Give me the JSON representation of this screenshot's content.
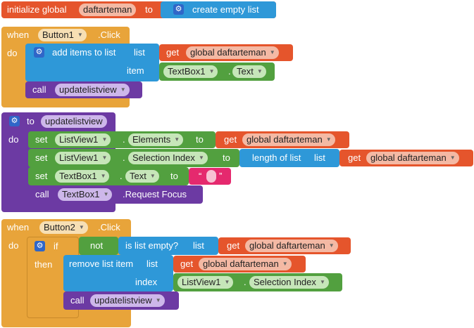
{
  "global_block": {
    "initialize_label": "initialize global",
    "var_name": "daftarteman",
    "to_label": "to",
    "create_label": "create empty list"
  },
  "button1_block": {
    "when_label": "when",
    "component": "Button1",
    "event": ".Click",
    "do_label": "do",
    "add_items_label": "add items to list",
    "list_label": "list",
    "get_label": "get",
    "get_var": "global daftarteman",
    "item_label": "item",
    "item_component": "TextBox1",
    "dot": ".",
    "item_property": "Text",
    "call_label": "call",
    "call_proc": "updatelistview"
  },
  "procedure_block": {
    "to_label": "to",
    "proc_name": "updatelistview",
    "do_label": "do",
    "set1": {
      "set_label": "set",
      "component": "ListView1",
      "dot": ".",
      "property": "Elements",
      "to_label": "to",
      "get_label": "get",
      "get_var": "global daftarteman"
    },
    "set2": {
      "set_label": "set",
      "component": "ListView1",
      "dot": ".",
      "property": "Selection Index",
      "to_label": "to",
      "length_label": "length of list",
      "list_label": "list",
      "get_label": "get",
      "get_var": "global daftarteman"
    },
    "set3": {
      "set_label": "set",
      "component": "TextBox1",
      "dot": ".",
      "property": "Text",
      "to_label": "to",
      "open_quote": "“",
      "close_quote": "”"
    },
    "call1": {
      "call_label": "call",
      "component": "TextBox1",
      "method": ".Request Focus"
    }
  },
  "button2_block": {
    "when_label": "when",
    "component": "Button2",
    "event": ".Click",
    "do_label": "do",
    "if_label": "if",
    "not_label": "not",
    "is_empty_label": "is list empty?",
    "list_label": "list",
    "get_label": "get",
    "get_var": "global daftarteman",
    "then_label": "then",
    "remove_label": "remove list item",
    "remove_list_label": "list",
    "remove_get_label": "get",
    "remove_get_var": "global daftarteman",
    "index_label": "index",
    "index_component": "ListView1",
    "dot": ".",
    "index_property": "Selection Index",
    "call_label": "call",
    "call_proc": "updatelistview"
  },
  "icons": {
    "gear": "gear-icon",
    "dropdown": "dropdown-arrow-icon"
  },
  "colors": {
    "event": "#e8a43a",
    "variable": "#e5552c",
    "list": "#2e98d8",
    "procedure": "#6c3aa3",
    "component": "#52a03f",
    "text": "#e5296e",
    "control": "#e8a43a"
  }
}
